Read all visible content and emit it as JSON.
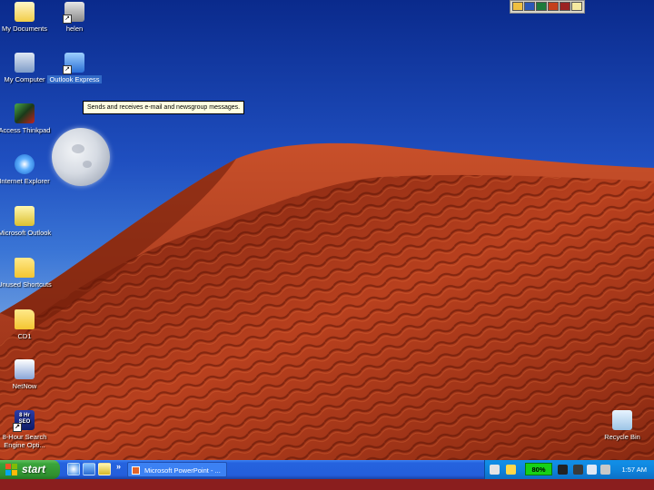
{
  "desktop": {
    "icons": [
      {
        "label": "My Documents",
        "icon": "folder-documents-icon"
      },
      {
        "label": "helen",
        "icon": "user-folder-icon"
      },
      {
        "label": "My Computer",
        "icon": "computer-icon"
      },
      {
        "label": "Outlook Express",
        "icon": "outlook-express-icon"
      },
      {
        "label": "Access Thinkpad",
        "icon": "access-thinkpad-icon"
      },
      {
        "label": "Internet Explorer",
        "icon": "internet-explorer-icon"
      },
      {
        "label": "Microsoft Outlook",
        "icon": "microsoft-outlook-icon"
      },
      {
        "label": "Unused Shortcuts",
        "icon": "folder-icon"
      },
      {
        "label": "CD1",
        "icon": "folder-icon"
      },
      {
        "label": "NetNow",
        "icon": "netnow-icon"
      },
      {
        "label": "8-Hour Search Engine Opti...",
        "icon": "seo-icon",
        "badge": "8 Hr SEO"
      },
      {
        "label": "Recycle Bin",
        "icon": "recycle-bin-icon"
      }
    ],
    "tooltip": "Sends and receives e-mail and newsgroup messages."
  },
  "office_toolbar": {
    "icons": [
      "office-icon",
      "word-icon",
      "excel-icon",
      "powerpoint-icon",
      "access-icon",
      "outlook-icon"
    ]
  },
  "taskbar": {
    "start_label": "start",
    "quick_launch": [
      "internet-explorer-icon",
      "desktop-icon",
      "outlook-icon"
    ],
    "more_label": "»",
    "task_label": "Microsoft PowerPoint - ...",
    "tray": {
      "performance": "80%",
      "clock": "1:57 AM"
    }
  },
  "colors": {
    "taskbar_blue": "#245edb",
    "start_green": "#3aa53a",
    "tray_blue": "#0f84dc",
    "tooltip_bg": "#ffffe1",
    "selection_blue": "#3169c6"
  }
}
